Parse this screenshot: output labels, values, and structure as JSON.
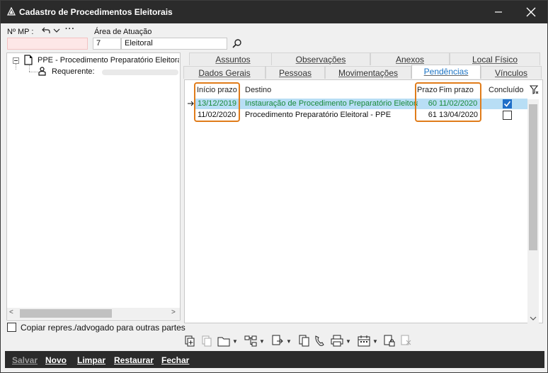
{
  "window": {
    "title": "Cadastro de Procedimentos Eleitorais"
  },
  "header": {
    "mp_label": "Nº MP :",
    "area_label": "Área de Atuação",
    "area_code": "7",
    "area_name": "Eleitoral"
  },
  "tree": {
    "root": "PPE - Procedimento Preparatório Eleitoral",
    "child_label": "Requerente:"
  },
  "tabs": {
    "row1": [
      "Assuntos",
      "Observações",
      "Anexos",
      "Local Físico"
    ],
    "row2": [
      "Dados Gerais",
      "Pessoas",
      "Movimentações",
      "Pendências",
      "Vínculos"
    ],
    "active": "Pendências"
  },
  "grid": {
    "columns": {
      "inicio": "Início prazo",
      "destino": "Destino",
      "prazo": "Prazo",
      "fim": "Fim prazo",
      "concluido": "Concluído"
    },
    "rows": [
      {
        "inicio": "13/12/2019",
        "destino": "Instauração de Procedimento Preparatório Eleitoral",
        "prazo": "60",
        "fim": "11/02/2020",
        "concluido": true
      },
      {
        "inicio": "11/02/2020",
        "destino": "Procedimento Preparatório Eleitoral - PPE",
        "prazo": "61",
        "fim": "13/04/2020",
        "concluido": false
      }
    ]
  },
  "copy_checkbox": {
    "label": "Copiar repres./advogado para outras partes"
  },
  "buttons": {
    "salvar": "Salvar",
    "novo": "Novo",
    "limpar": "Limpar",
    "restaurar": "Restaurar",
    "fechar": "Fechar"
  },
  "colors": {
    "titlebar": "#2b2b2b",
    "accent": "#1b73c4",
    "highlight": "#e07c1a",
    "selection": "#b8def5",
    "green_text": "#1a8a3a"
  }
}
